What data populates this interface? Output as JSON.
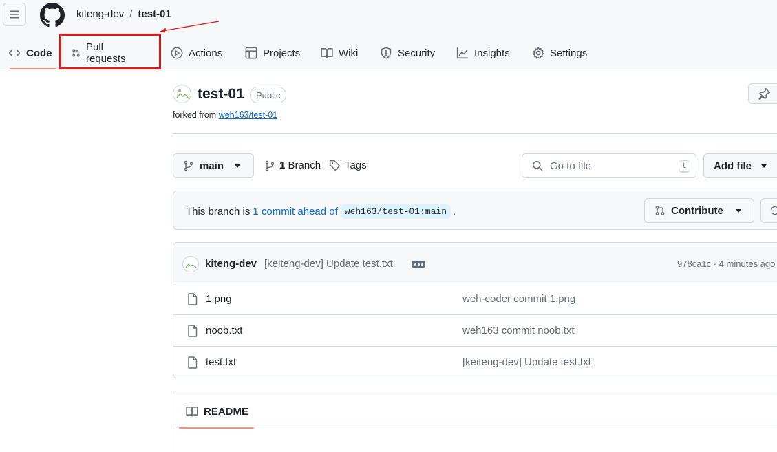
{
  "header": {
    "owner": "kiteng-dev",
    "separator": "/",
    "repo": "test-01"
  },
  "tabs": [
    {
      "label": "Code",
      "icon": "code-icon",
      "active": true
    },
    {
      "label": "Pull requests",
      "icon": "git-pull-request-icon"
    },
    {
      "label": "Actions",
      "icon": "play-icon"
    },
    {
      "label": "Projects",
      "icon": "table-icon"
    },
    {
      "label": "Wiki",
      "icon": "book-icon"
    },
    {
      "label": "Security",
      "icon": "shield-icon"
    },
    {
      "label": "Insights",
      "icon": "graph-icon"
    },
    {
      "label": "Settings",
      "icon": "gear-icon"
    }
  ],
  "annotation": {
    "highlight_color": "#e11919",
    "highlighted_tab": "Pull requests"
  },
  "repo": {
    "title": "test-01",
    "visibility": "Public",
    "forked_prefix": "forked from",
    "forked_from": "weh163/test-01"
  },
  "toolbar": {
    "branch": "main",
    "branch_count": "1",
    "branch_label": "Branch",
    "tags_label": "Tags",
    "search_placeholder": "Go to file",
    "search_shortcut": "t",
    "add_file": "Add file"
  },
  "ahead_banner": {
    "prefix": "This branch is",
    "link": "1 commit ahead of",
    "ref": "weh163/test-01:main",
    "suffix": ".",
    "contribute": "Contribute"
  },
  "latest_commit": {
    "author": "kiteng-dev",
    "message": "[keiteng-dev] Update test.txt",
    "meta": "978ca1c · 4 minutes ago"
  },
  "files": [
    {
      "name": "1.png",
      "commit": "weh-coder commit 1.png"
    },
    {
      "name": "noob.txt",
      "commit": "weh163 commit noob.txt"
    },
    {
      "name": "test.txt",
      "commit": "[keiteng-dev] Update test.txt"
    }
  ],
  "readme": {
    "label": "README"
  },
  "colors": {
    "accent_underline": "#fd8c73",
    "link": "#0969da",
    "border": "#d0d7de"
  }
}
